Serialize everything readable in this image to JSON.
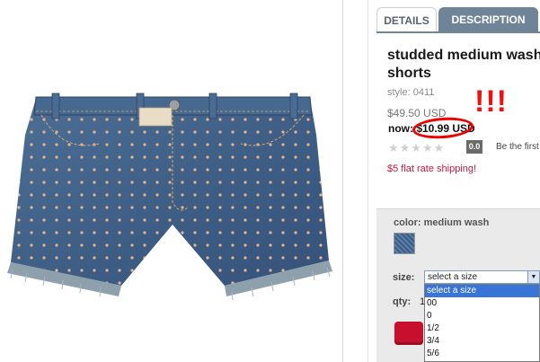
{
  "tabs": [
    {
      "label": "DETAILS",
      "active": true
    },
    {
      "label": "DESCRIPTION",
      "active": false
    }
  ],
  "product": {
    "title_line1": "studded medium wash",
    "title_line2": "shorts",
    "style": "style: 0411",
    "was_price": "$49.50 USD",
    "now_label": "now",
    "now_price": ": $10.99 USD",
    "annotation": "!!!",
    "rating_value": "0.0",
    "be_first_text": "Be the first",
    "shipping_text": "$5 flat rate shipping!"
  },
  "options": {
    "color_label": "color: medium wash",
    "size_label": "size:",
    "size_selected": "select a size",
    "size_options": [
      "select a size",
      "00",
      "0",
      "1/2",
      "3/4",
      "5/6"
    ],
    "qty_label": "qty:",
    "qty_value": "1"
  },
  "colors": {
    "tab_active_bg": "#6f8497",
    "price_circle": "#e00000",
    "shipping": "#c8143c",
    "add_button": "#c8102e",
    "dropdown_highlight": "#3875d7"
  },
  "icons": {
    "stars": "star-rating-icon",
    "dropdown_arrow": "chevron-down-icon"
  }
}
